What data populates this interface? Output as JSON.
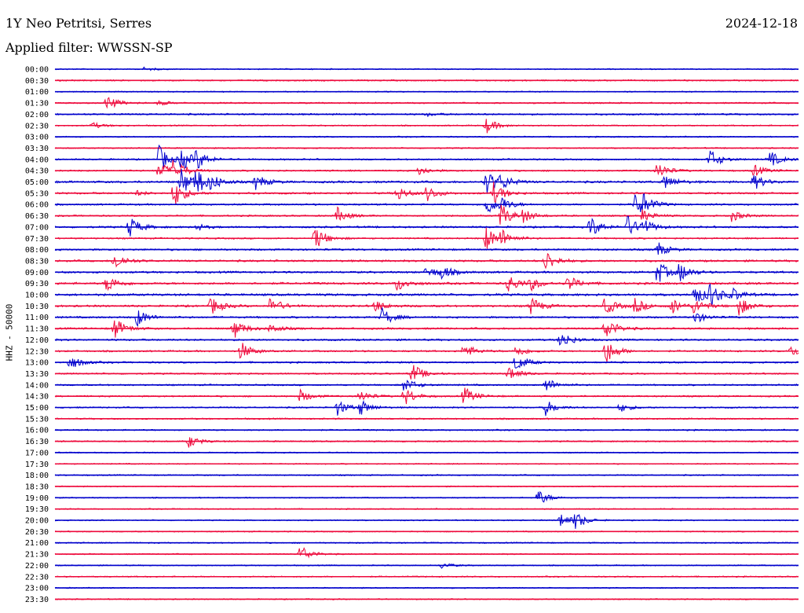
{
  "header": {
    "station": "1Y Neo Petritsi, Serres",
    "date": "2024-12-18",
    "filter": "Applied filter: WWSSN-SP"
  },
  "chart_data": {
    "type": "line",
    "title": "1Y Neo Petritsi, Serres",
    "subtitle": "Applied filter: WWSSN-SP",
    "ylabel": "HHZ - 50000",
    "colors": [
      "#0000cc",
      "#ee0a3c"
    ],
    "row_labels": [
      "00:00",
      "00:30",
      "01:00",
      "01:30",
      "02:00",
      "02:30",
      "03:00",
      "03:30",
      "04:00",
      "04:30",
      "05:00",
      "05:30",
      "06:00",
      "06:30",
      "07:00",
      "07:30",
      "08:00",
      "08:30",
      "09:00",
      "09:30",
      "10:00",
      "10:30",
      "11:00",
      "11:30",
      "12:00",
      "12:30",
      "13:00",
      "13:30",
      "14:00",
      "14:30",
      "15:00",
      "15:30",
      "16:00",
      "16:30",
      "17:00",
      "17:30",
      "18:00",
      "18:30",
      "19:00",
      "19:30",
      "20:00",
      "20:30",
      "21:00",
      "21:30",
      "22:00",
      "22:30",
      "23:00",
      "23:30"
    ],
    "noise_level": [
      0.8,
      1.0,
      0.8,
      1.0,
      1.2,
      0.9,
      0.9,
      0.9,
      1.1,
      1.1,
      1.5,
      1.3,
      1.2,
      1.1,
      1.3,
      1.1,
      1.3,
      1.4,
      1.4,
      1.5,
      1.6,
      1.4,
      1.3,
      1.3,
      1.3,
      1.2,
      1.2,
      1.1,
      1.1,
      1.1,
      1.0,
      1.0,
      1.0,
      1.0,
      0.8,
      0.8,
      0.9,
      0.8,
      0.8,
      0.8,
      0.8,
      0.8,
      0.9,
      0.8,
      0.8,
      0.9,
      0.8,
      0.8
    ],
    "events": [
      [
        0,
        [
          [
            0.12,
            2
          ]
        ]
      ],
      [
        3,
        [
          [
            0.07,
            10
          ],
          [
            0.14,
            3
          ]
        ]
      ],
      [
        4,
        [
          [
            0.5,
            2
          ]
        ]
      ],
      [
        5,
        [
          [
            0.05,
            4
          ],
          [
            0.58,
            10
          ]
        ]
      ],
      [
        8,
        [
          [
            0.14,
            18
          ],
          [
            0.17,
            14
          ],
          [
            0.19,
            12
          ],
          [
            0.88,
            14
          ],
          [
            0.96,
            12
          ]
        ]
      ],
      [
        9,
        [
          [
            0.14,
            12
          ],
          [
            0.16,
            16
          ],
          [
            0.49,
            6
          ],
          [
            0.81,
            12
          ],
          [
            0.94,
            8
          ]
        ]
      ],
      [
        10,
        [
          [
            0.17,
            18
          ],
          [
            0.19,
            16
          ],
          [
            0.21,
            8
          ],
          [
            0.27,
            10
          ],
          [
            0.58,
            16
          ],
          [
            0.6,
            8
          ],
          [
            0.82,
            10
          ],
          [
            0.94,
            10
          ]
        ]
      ],
      [
        11,
        [
          [
            0.16,
            18
          ],
          [
            0.11,
            3
          ],
          [
            0.46,
            10
          ],
          [
            0.5,
            10
          ],
          [
            0.59,
            14
          ]
        ]
      ],
      [
        12,
        [
          [
            0.58,
            14
          ],
          [
            0.6,
            8
          ],
          [
            0.78,
            14
          ],
          [
            0.79,
            10
          ]
        ]
      ],
      [
        13,
        [
          [
            0.6,
            16
          ],
          [
            0.63,
            8
          ],
          [
            0.38,
            10
          ],
          [
            0.79,
            8
          ],
          [
            0.91,
            8
          ]
        ]
      ],
      [
        14,
        [
          [
            0.1,
            14
          ],
          [
            0.19,
            4
          ],
          [
            0.72,
            14
          ],
          [
            0.77,
            14
          ],
          [
            0.79,
            10
          ]
        ]
      ],
      [
        15,
        [
          [
            0.35,
            16
          ],
          [
            0.58,
            16
          ],
          [
            0.6,
            10
          ]
        ]
      ],
      [
        16,
        [
          [
            0.81,
            10
          ]
        ]
      ],
      [
        17,
        [
          [
            0.08,
            12
          ],
          [
            0.66,
            14
          ]
        ]
      ],
      [
        18,
        [
          [
            0.5,
            8
          ],
          [
            0.52,
            8
          ],
          [
            0.81,
            16
          ],
          [
            0.84,
            12
          ]
        ]
      ],
      [
        19,
        [
          [
            0.07,
            12
          ],
          [
            0.46,
            10
          ],
          [
            0.61,
            12
          ],
          [
            0.64,
            8
          ],
          [
            0.69,
            10
          ]
        ]
      ],
      [
        20,
        [
          [
            0.86,
            14
          ],
          [
            0.88,
            16
          ],
          [
            0.91,
            8
          ]
        ]
      ],
      [
        21,
        [
          [
            0.21,
            12
          ],
          [
            0.29,
            12
          ],
          [
            0.43,
            8
          ],
          [
            0.64,
            12
          ],
          [
            0.74,
            12
          ],
          [
            0.78,
            10
          ],
          [
            0.83,
            10
          ],
          [
            0.86,
            10
          ],
          [
            0.92,
            12
          ]
        ]
      ],
      [
        22,
        [
          [
            0.11,
            12
          ],
          [
            0.44,
            12
          ],
          [
            0.86,
            8
          ]
        ]
      ],
      [
        23,
        [
          [
            0.08,
            14
          ],
          [
            0.24,
            14
          ],
          [
            0.29,
            6
          ],
          [
            0.74,
            16
          ]
        ]
      ],
      [
        24,
        [
          [
            0.68,
            12
          ]
        ]
      ],
      [
        25,
        [
          [
            0.25,
            12
          ],
          [
            0.55,
            10
          ],
          [
            0.62,
            8
          ],
          [
            0.74,
            18
          ],
          [
            0.99,
            6
          ]
        ]
      ],
      [
        26,
        [
          [
            0.02,
            10
          ],
          [
            0.62,
            12
          ]
        ]
      ],
      [
        27,
        [
          [
            0.48,
            14
          ],
          [
            0.61,
            10
          ]
        ]
      ],
      [
        28,
        [
          [
            0.47,
            10
          ],
          [
            0.66,
            10
          ]
        ]
      ],
      [
        29,
        [
          [
            0.33,
            8
          ],
          [
            0.41,
            8
          ],
          [
            0.47,
            12
          ],
          [
            0.55,
            12
          ]
        ]
      ],
      [
        30,
        [
          [
            0.38,
            10
          ],
          [
            0.41,
            10
          ],
          [
            0.66,
            10
          ],
          [
            0.76,
            6
          ]
        ]
      ],
      [
        33,
        [
          [
            0.18,
            8
          ]
        ]
      ],
      [
        38,
        [
          [
            0.65,
            10
          ]
        ]
      ],
      [
        40,
        [
          [
            0.68,
            10
          ],
          [
            0.7,
            10
          ]
        ]
      ],
      [
        43,
        [
          [
            0.33,
            12
          ]
        ]
      ],
      [
        44,
        [
          [
            0.52,
            4
          ]
        ]
      ]
    ]
  }
}
